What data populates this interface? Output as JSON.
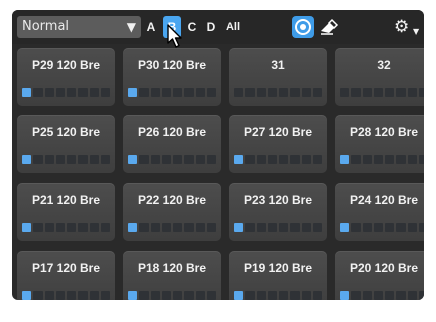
{
  "toolbar": {
    "mode_select": {
      "value": "Normal"
    },
    "banks": [
      "A",
      "B",
      "C",
      "D",
      "All"
    ],
    "selected_bank": "B",
    "icons": {
      "record": "record-circle-icon",
      "clear": "eraser-icon",
      "settings": "gear-icon",
      "dropdown": "caret-down-icon"
    },
    "accent_color": "#4aa6f0"
  },
  "pads": [
    {
      "label": "P29 120 Bre",
      "level_segments": 1
    },
    {
      "label": "P30 120 Bre",
      "level_segments": 1
    },
    {
      "label": "31",
      "level_segments": 0
    },
    {
      "label": "32",
      "level_segments": 0
    },
    {
      "label": "P25 120 Bre",
      "level_segments": 1
    },
    {
      "label": "P26 120 Bre",
      "level_segments": 1
    },
    {
      "label": "P27 120 Bre",
      "level_segments": 1
    },
    {
      "label": "P28 120 Bre",
      "level_segments": 1
    },
    {
      "label": "P21 120 Bre",
      "level_segments": 1
    },
    {
      "label": "P22 120 Bre",
      "level_segments": 1
    },
    {
      "label": "P23 120 Bre",
      "level_segments": 1
    },
    {
      "label": "P24 120 Bre",
      "level_segments": 1
    },
    {
      "label": "P17 120 Bre",
      "level_segments": 1
    },
    {
      "label": "P18 120 Bre",
      "level_segments": 1
    },
    {
      "label": "P19 120 Bre",
      "level_segments": 1
    },
    {
      "label": "P20 120 Bre",
      "level_segments": 1
    }
  ],
  "segments_per_pad": 8
}
